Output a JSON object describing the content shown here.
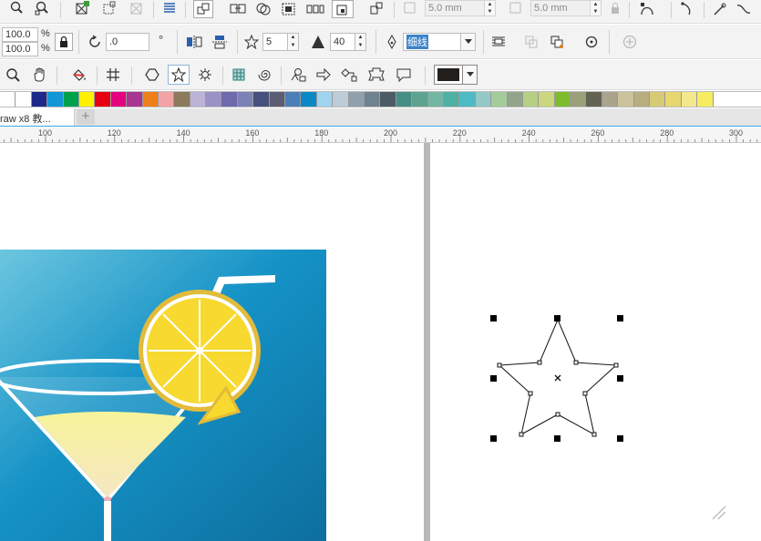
{
  "toolbar1": {
    "outline_width_1": "5.0 mm",
    "outline_width_2": "5.0 mm"
  },
  "property_bar": {
    "scale_x": "100.0",
    "scale_y": "100.0",
    "scale_unit_x": "%",
    "scale_unit_y": "%",
    "rotation": ".0",
    "degree_symbol": "°",
    "star_points": "5",
    "star_sharpness": "40",
    "outline_type": "细线",
    "fill_color": "#231f1c"
  },
  "palette": [
    "#ffffff",
    "#ffffff",
    "#1d2a8a",
    "#1296d6",
    "#00a14b",
    "#fff100",
    "#e60012",
    "#e4007f",
    "#a8358f",
    "#ee7f1a",
    "#f3a3a6",
    "#8c7a5b",
    "#bcb4d6",
    "#9a91c5",
    "#6f6aad",
    "#7c82b6",
    "#46507e",
    "#5c5d74",
    "#4a80b7",
    "#0a88c6",
    "#9fd4f1",
    "#bcccd8",
    "#90a0ac",
    "#6e8290",
    "#4d5b64",
    "#468f87",
    "#5da390",
    "#73b6a4",
    "#4fb0a4",
    "#4dbac4",
    "#93c9c7",
    "#a4cc9b",
    "#92a58a",
    "#b6cf82",
    "#cbd67f",
    "#7cbc2e",
    "#9aa17a",
    "#626353",
    "#a9a48b",
    "#cbc39c",
    "#b9ae80",
    "#d6ca75",
    "#e8d671",
    "#f3e98c",
    "#f7eb60"
  ],
  "document_tab": {
    "title": "raw x8 教...",
    "add_symbol": "+"
  },
  "ruler": [
    "100",
    "120",
    "140",
    "160",
    "180",
    "200",
    "220",
    "240",
    "260",
    "280",
    "300"
  ]
}
